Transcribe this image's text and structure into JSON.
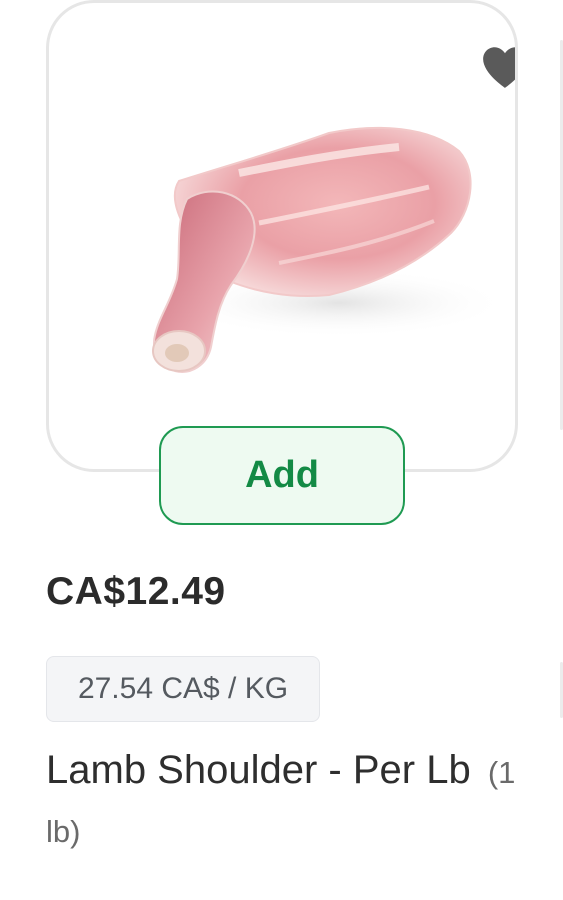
{
  "product": {
    "add_label": "Add",
    "price": "CA$12.49",
    "unit_price": "27.54 CA$ / KG",
    "name": "Lamb Shoulder - Per Lb",
    "quantity": "(1 lb)",
    "favorite_icon": "heart-icon",
    "image_subject": "lamb-shoulder-photo"
  },
  "colors": {
    "add_text": "#138a45",
    "add_border": "#1f9a52",
    "add_bg": "#eefaf1",
    "heart": "#5a5a5a"
  }
}
